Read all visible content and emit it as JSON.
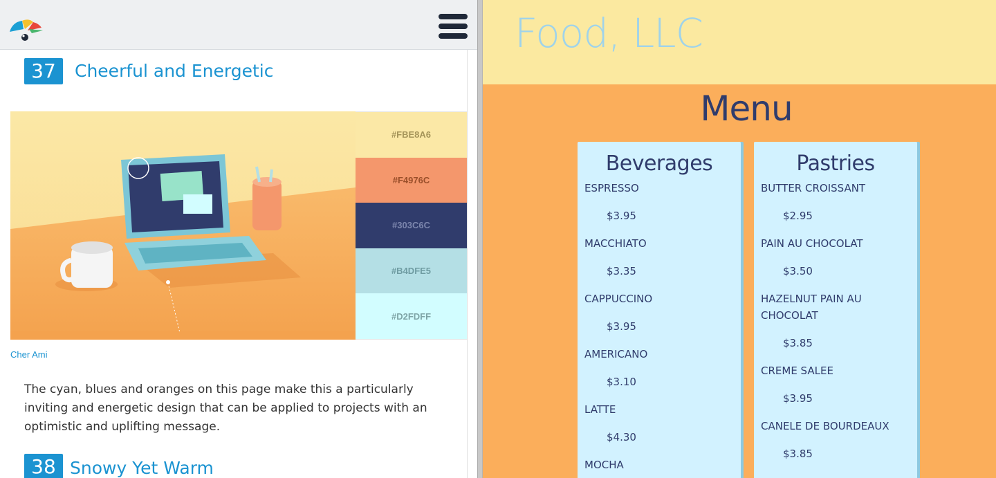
{
  "left_page": {
    "sections": [
      {
        "number": "37",
        "title": "Cheerful and Energetic"
      },
      {
        "number": "38",
        "title": "Snowy Yet Warm"
      }
    ],
    "palette": [
      {
        "hex_label": "#FBE8A6",
        "color": "#FBE8A6",
        "text_color": "#a59459"
      },
      {
        "hex_label": "#F4976C",
        "color": "#F4976C",
        "text_color": "#9a4f2a"
      },
      {
        "hex_label": "#303C6C",
        "color": "#303C6C",
        "text_color": "#7c86ad"
      },
      {
        "hex_label": "#B4DFE5",
        "color": "#B4DFE5",
        "text_color": "#6f9ca2"
      },
      {
        "hex_label": "#D2FDFF",
        "color": "#D2FDFF",
        "text_color": "#7ea4a6"
      }
    ],
    "image_credit": "Cher Ami",
    "description": "The cyan, blues and oranges on this page make this a particularly inviting and energetic design that can be applied to projects with an optimistic and uplifting message."
  },
  "right_page": {
    "site_title": "Food, LLC",
    "menu_heading": "Menu",
    "categories": [
      {
        "title": "Beverages",
        "items": [
          {
            "name": "ESPRESSO",
            "price": "$3.95"
          },
          {
            "name": "MACCHIATO",
            "price": "$3.35"
          },
          {
            "name": "CAPPUCCINO",
            "price": "$3.95"
          },
          {
            "name": "AMERICANO",
            "price": "$3.10"
          },
          {
            "name": "LATTE",
            "price": "$4.30"
          },
          {
            "name": "MOCHA",
            "price": ""
          }
        ]
      },
      {
        "title": "Pastries",
        "items": [
          {
            "name": "BUTTER CROISSANT",
            "price": "$2.95"
          },
          {
            "name": "PAIN AU CHOCOLAT",
            "price": "$3.50"
          },
          {
            "name": "HAZELNUT PAIN AU CHOCOLAT",
            "price": "$3.85"
          },
          {
            "name": "CREME SALEE",
            "price": "$3.95"
          },
          {
            "name": "CANELE DE BOURDEAUX",
            "price": "$3.85"
          }
        ]
      }
    ]
  },
  "colors": {
    "accent_blue": "#1b93d1",
    "header_yellow": "#fbe9a0",
    "body_orange": "#fbae5b",
    "card_blue": "#d2f2ff",
    "navy": "#303c6c"
  },
  "icons": [
    "brand-logo-icon",
    "hamburger-menu-icon"
  ]
}
